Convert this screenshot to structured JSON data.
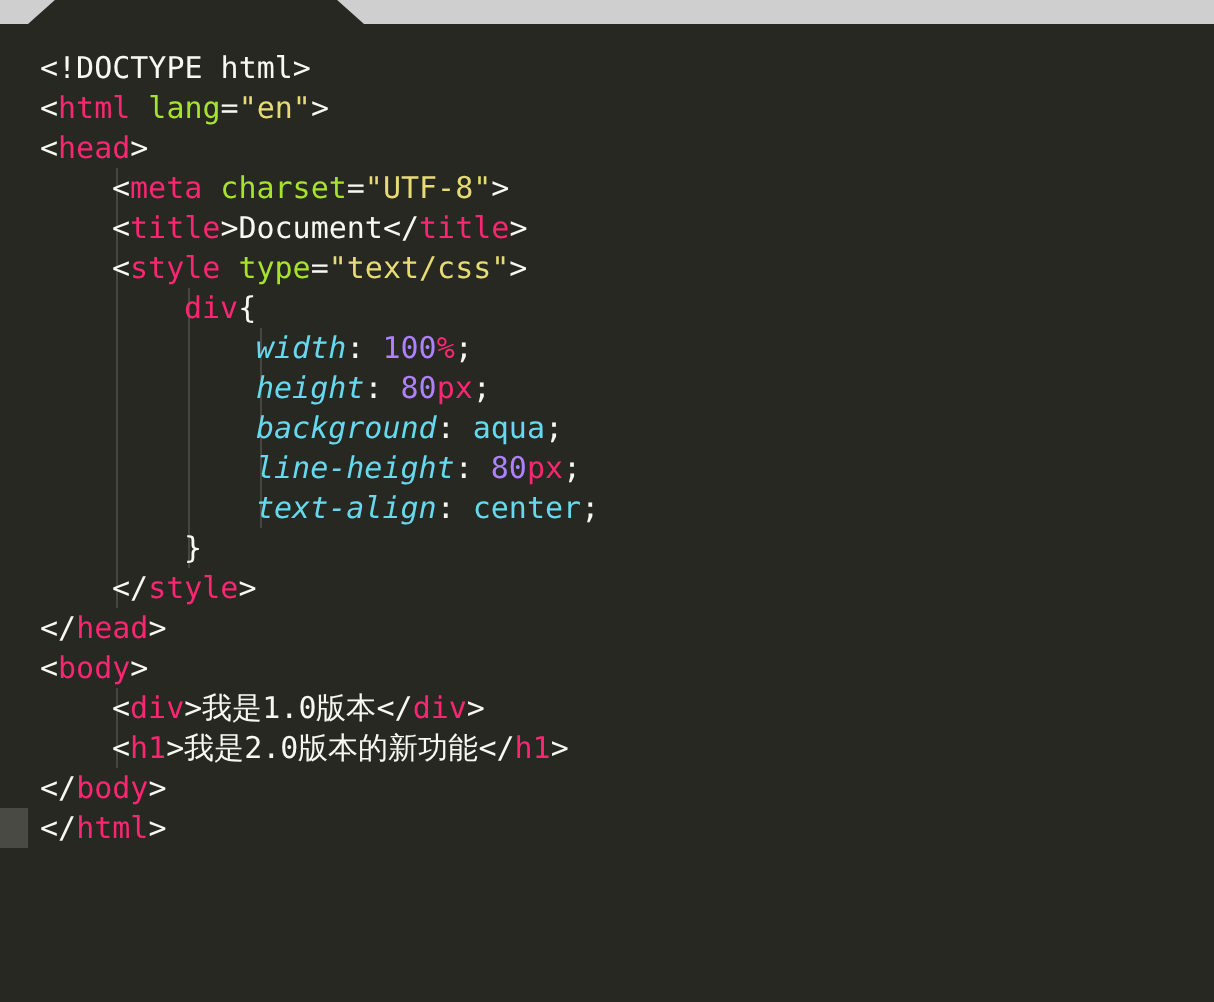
{
  "tab": {
    "selected": true
  },
  "lines": [
    {
      "current": false,
      "tokens": [
        {
          "kind": "punct",
          "text": "<!DOCTYPE html>"
        }
      ]
    },
    {
      "current": false,
      "tokens": [
        {
          "kind": "punct",
          "text": "<"
        },
        {
          "kind": "tag",
          "text": "html"
        },
        {
          "kind": "attr",
          "text": "lang"
        },
        {
          "kind": "punct",
          "text": "="
        },
        {
          "kind": "string",
          "text": "\"en\""
        },
        {
          "kind": "punct",
          "text": ">"
        }
      ]
    },
    {
      "current": false,
      "tokens": [
        {
          "kind": "punct",
          "text": "<"
        },
        {
          "kind": "tag",
          "text": "head"
        },
        {
          "kind": "punct",
          "text": ">"
        }
      ],
      "children": [
        {
          "current": false,
          "tokens": [
            {
              "kind": "punct",
              "text": "<"
            },
            {
              "kind": "tag",
              "text": "meta"
            },
            {
              "kind": "attr",
              "text": "charset"
            },
            {
              "kind": "punct",
              "text": "="
            },
            {
              "kind": "string",
              "text": "\"UTF-8\""
            },
            {
              "kind": "punct",
              "text": ">"
            }
          ]
        },
        {
          "current": false,
          "tokens": [
            {
              "kind": "punct",
              "text": "<"
            },
            {
              "kind": "tag",
              "text": "title"
            },
            {
              "kind": "punct",
              "text": ">Document</"
            },
            {
              "kind": "tag",
              "text": "title"
            },
            {
              "kind": "punct",
              "text": ">"
            }
          ]
        },
        {
          "current": false,
          "tokens": [
            {
              "kind": "punct",
              "text": "<"
            },
            {
              "kind": "tag",
              "text": "style"
            },
            {
              "kind": "attr",
              "text": "type"
            },
            {
              "kind": "punct",
              "text": "="
            },
            {
              "kind": "string",
              "text": "\"text/css\""
            },
            {
              "kind": "punct",
              "text": ">"
            }
          ],
          "children": [
            {
              "current": false,
              "tokens": [
                {
                  "kind": "tag",
                  "text": "div"
                },
                {
                  "kind": "punct",
                  "text": "{"
                }
              ],
              "children": [
                {
                  "current": false,
                  "tokens": [
                    {
                      "kind": "prop",
                      "text": "width"
                    },
                    {
                      "kind": "punct",
                      "text": ": "
                    },
                    {
                      "kind": "number",
                      "text": "100"
                    },
                    {
                      "kind": "unit",
                      "text": "%"
                    },
                    {
                      "kind": "punct",
                      "text": ";"
                    }
                  ]
                },
                {
                  "current": false,
                  "tokens": [
                    {
                      "kind": "prop",
                      "text": "height"
                    },
                    {
                      "kind": "punct",
                      "text": ": "
                    },
                    {
                      "kind": "number",
                      "text": "80"
                    },
                    {
                      "kind": "unit",
                      "text": "px"
                    },
                    {
                      "kind": "punct",
                      "text": ";"
                    }
                  ]
                },
                {
                  "current": false,
                  "tokens": [
                    {
                      "kind": "prop",
                      "text": "background"
                    },
                    {
                      "kind": "punct",
                      "text": ": "
                    },
                    {
                      "kind": "value",
                      "text": "aqua"
                    },
                    {
                      "kind": "punct",
                      "text": ";"
                    }
                  ]
                },
                {
                  "current": false,
                  "tokens": [
                    {
                      "kind": "prop",
                      "text": "line-height"
                    },
                    {
                      "kind": "punct",
                      "text": ": "
                    },
                    {
                      "kind": "number",
                      "text": "80"
                    },
                    {
                      "kind": "unit",
                      "text": "px"
                    },
                    {
                      "kind": "punct",
                      "text": ";"
                    }
                  ]
                },
                {
                  "current": false,
                  "tokens": [
                    {
                      "kind": "prop",
                      "text": "text-align"
                    },
                    {
                      "kind": "punct",
                      "text": ": "
                    },
                    {
                      "kind": "value",
                      "text": "center"
                    },
                    {
                      "kind": "punct",
                      "text": ";"
                    }
                  ]
                }
              ]
            },
            {
              "current": false,
              "tokens": [
                {
                  "kind": "punct",
                  "text": "}"
                }
              ]
            }
          ]
        },
        {
          "current": false,
          "tokens": [
            {
              "kind": "punct",
              "text": "</"
            },
            {
              "kind": "tag",
              "text": "style"
            },
            {
              "kind": "punct",
              "text": ">"
            }
          ]
        }
      ]
    },
    {
      "current": false,
      "tokens": [
        {
          "kind": "punct",
          "text": "</"
        },
        {
          "kind": "tag",
          "text": "head"
        },
        {
          "kind": "punct",
          "text": ">"
        }
      ]
    },
    {
      "current": false,
      "tokens": [
        {
          "kind": "punct",
          "text": "<"
        },
        {
          "kind": "tag",
          "text": "body"
        },
        {
          "kind": "punct",
          "text": ">"
        }
      ],
      "children": [
        {
          "current": false,
          "tokens": [
            {
              "kind": "punct",
              "text": "<"
            },
            {
              "kind": "tag",
              "text": "div"
            },
            {
              "kind": "punct",
              "text": ">我是1.0版本</"
            },
            {
              "kind": "tag",
              "text": "div"
            },
            {
              "kind": "punct",
              "text": ">"
            }
          ]
        },
        {
          "current": false,
          "tokens": [
            {
              "kind": "punct",
              "text": "<"
            },
            {
              "kind": "tag",
              "text": "h1"
            },
            {
              "kind": "punct",
              "text": ">我是2.0版本的新功能</"
            },
            {
              "kind": "tag",
              "text": "h1"
            },
            {
              "kind": "punct",
              "text": ">"
            }
          ]
        }
      ]
    },
    {
      "current": false,
      "tokens": [
        {
          "kind": "punct",
          "text": "</"
        },
        {
          "kind": "tag",
          "text": "body"
        },
        {
          "kind": "punct",
          "text": ">"
        }
      ]
    },
    {
      "current": true,
      "tokens": [
        {
          "kind": "punct",
          "text": "</"
        },
        {
          "kind": "tag",
          "text": "html"
        },
        {
          "kind": "punct",
          "text": ">"
        }
      ]
    }
  ]
}
